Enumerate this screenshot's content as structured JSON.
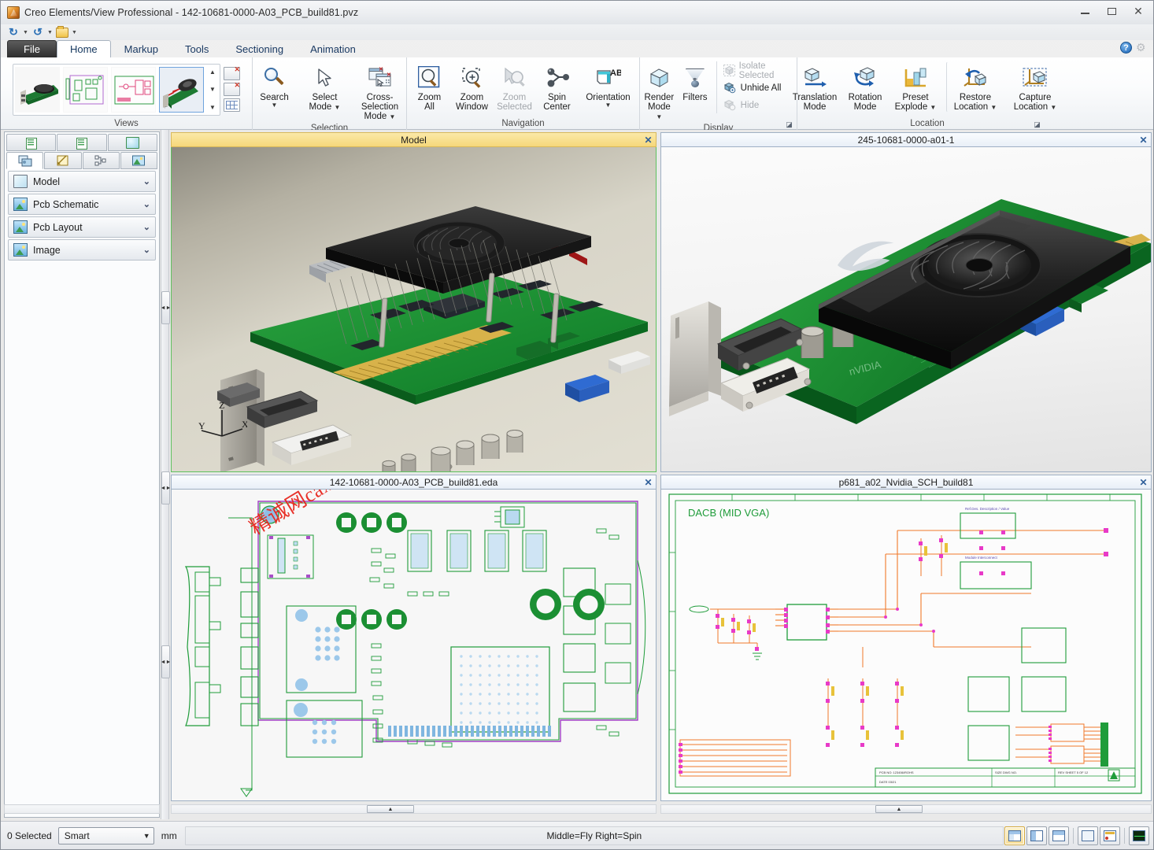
{
  "window": {
    "title": "Creo Elements/View Professional - 142-10681-0000-A03_PCB_build81.pvz",
    "app_icon": "creo-app-icon",
    "minimize": "–",
    "maximize": "□",
    "close": "✕"
  },
  "quick_access": {
    "items": [
      {
        "name": "redo",
        "glyph": "↻"
      },
      {
        "name": "redo-dropdown",
        "glyph": "▾"
      },
      {
        "name": "undo",
        "glyph": "↺"
      },
      {
        "name": "undo-dropdown",
        "glyph": "▾"
      },
      {
        "name": "open-folder",
        "glyph": ""
      },
      {
        "name": "customize-qat",
        "glyph": "▾"
      }
    ]
  },
  "ribbon": {
    "tabs": [
      {
        "label": "File",
        "kind": "file"
      },
      {
        "label": "Home",
        "kind": "active"
      },
      {
        "label": "Markup",
        "kind": "normal"
      },
      {
        "label": "Tools",
        "kind": "normal"
      },
      {
        "label": "Sectioning",
        "kind": "normal"
      },
      {
        "label": "Animation",
        "kind": "normal"
      }
    ],
    "help_button": "?",
    "options_button": "⚙",
    "groups": [
      {
        "name": "views",
        "label": "Views",
        "thumbnails": [
          {
            "name": "view-thumb-photo",
            "selected": false
          },
          {
            "name": "view-thumb-pcb-layout",
            "selected": false
          },
          {
            "name": "view-thumb-schematic",
            "selected": false
          },
          {
            "name": "view-thumb-model-exploded",
            "selected": true
          }
        ],
        "scroll_up": "▲",
        "scroll_down": "▼",
        "scroll_more": "▼",
        "extras": [
          {
            "name": "delete-view-button"
          },
          {
            "name": "delete-all-views-button"
          },
          {
            "name": "views-grid-button"
          }
        ]
      },
      {
        "name": "selection",
        "label": "Selection",
        "buttons": [
          {
            "label": "Search",
            "icon": "magnifier-icon",
            "dropdown": true,
            "disabled": false
          },
          {
            "label": "Select\nMode",
            "icon": "cursor-arrow-icon",
            "dropdown": true,
            "disabled": false,
            "label_line1": "Select",
            "label_line2": "Mode"
          },
          {
            "label": "Cross-Selection\nMode",
            "icon": "cross-selection-icon",
            "dropdown": true,
            "disabled": false,
            "label_line1": "Cross-Selection",
            "label_line2": "Mode"
          }
        ]
      },
      {
        "name": "navigation",
        "label": "Navigation",
        "buttons": [
          {
            "label_line1": "Zoom",
            "label_line2": "All",
            "icon": "zoom-all-icon",
            "disabled": false
          },
          {
            "label_line1": "Zoom",
            "label_line2": "Window",
            "icon": "zoom-window-icon",
            "disabled": false
          },
          {
            "label_line1": "Zoom",
            "label_line2": "Selected",
            "icon": "zoom-selected-icon",
            "disabled": true
          },
          {
            "label_line1": "Spin",
            "label_line2": "Center",
            "icon": "spin-center-icon",
            "disabled": false
          },
          {
            "label_line1": "Orientation",
            "label_line2": "",
            "icon": "orientation-icon",
            "dropdown": true,
            "disabled": false
          }
        ]
      },
      {
        "name": "display",
        "label": "Display",
        "dialog_launcher": "⌐",
        "buttons": [
          {
            "label_line1": "Render",
            "label_line2": "Mode",
            "icon": "render-mode-icon",
            "dropdown": true,
            "disabled": false
          },
          {
            "label_line1": "Filters",
            "label_line2": "",
            "icon": "filters-icon",
            "disabled": false
          }
        ],
        "small_buttons": [
          {
            "label": "Isolate Selected",
            "icon": "isolate-icon",
            "disabled": true
          },
          {
            "label": "Unhide All",
            "icon": "unhide-icon",
            "disabled": false
          },
          {
            "label": "Hide",
            "icon": "hide-icon",
            "disabled": true
          }
        ]
      },
      {
        "name": "location",
        "label": "Location",
        "dialog_launcher": "⌐",
        "buttons": [
          {
            "label_line1": "Translation",
            "label_line2": "Mode",
            "icon": "translation-mode-icon",
            "disabled": false
          },
          {
            "label_line1": "Rotation",
            "label_line2": "Mode",
            "icon": "rotation-mode-icon",
            "disabled": false
          },
          {
            "label_line1": "Preset",
            "label_line2": "Explode",
            "icon": "preset-explode-icon",
            "dropdown": true,
            "disabled": false
          },
          {
            "label_line1": "Restore",
            "label_line2": "Location",
            "icon": "restore-location-icon",
            "dropdown": true,
            "disabled": false
          },
          {
            "label_line1": "Capture",
            "label_line2": "Location",
            "icon": "capture-location-icon",
            "dropdown": true,
            "disabled": false
          }
        ]
      }
    ]
  },
  "sidebar": {
    "top_tabs": [
      {
        "name": "structure-tab-1",
        "icon": "tree-icon"
      },
      {
        "name": "structure-tab-2",
        "icon": "tree-icon"
      },
      {
        "name": "structure-tab-3",
        "icon": "cube-icon"
      }
    ],
    "bottom_tabs": [
      {
        "name": "views-tab",
        "icon": "views-icon",
        "active": true
      },
      {
        "name": "markup-tab",
        "icon": "markup-icon",
        "active": false
      },
      {
        "name": "structure-tree-tab",
        "icon": "hierarchy-icon",
        "active": false
      },
      {
        "name": "images-tab",
        "icon": "image-icon",
        "active": false
      }
    ],
    "items": [
      {
        "label": "Model",
        "icon": "cube-icon",
        "chevron": "⌄"
      },
      {
        "label": "Pcb Schematic",
        "icon": "image-icon",
        "chevron": "⌄"
      },
      {
        "label": "Pcb Layout",
        "icon": "image-icon",
        "chevron": "⌄"
      },
      {
        "label": "Image",
        "icon": "image-icon",
        "chevron": "⌄"
      }
    ]
  },
  "viewports": [
    {
      "name": "viewport-model",
      "title": "Model",
      "active": true,
      "close": "✕",
      "content_type": "3d-exploded-graphics-card",
      "axis": {
        "x": "X",
        "y": "Y",
        "z": "Z"
      }
    },
    {
      "name": "viewport-photo",
      "title": "245-10681-0000-a01-1",
      "active": false,
      "close": "✕",
      "content_type": "3d-rendered-graphics-card"
    },
    {
      "name": "viewport-pcb-layout",
      "title": "142-10681-0000-A03_PCB_build81.eda",
      "active": false,
      "close": "✕",
      "content_type": "pcb-layout-drawing"
    },
    {
      "name": "viewport-schematic",
      "title": "p681_a02_Nvidia_SCH_build81",
      "active": false,
      "close": "✕",
      "content_type": "schematic-drawing",
      "sheet_label": "DACB (MID VGA)"
    }
  ],
  "watermark": {
    "text": "精诚网caxit.com",
    "color": "#e8271f"
  },
  "statusbar": {
    "selection_count": "0 Selected",
    "mode_select": {
      "value": "Smart",
      "arrow": "▼"
    },
    "units": "mm",
    "mouse_hint": "Middle=Fly   Right=Spin",
    "layout_buttons": [
      {
        "name": "layout-quad-button",
        "selected": true,
        "style": "q"
      },
      {
        "name": "layout-vertical-split-button",
        "selected": false,
        "style": "v"
      },
      {
        "name": "layout-horizontal-split-button",
        "selected": false,
        "style": "h"
      },
      {
        "name": "layout-single-button",
        "selected": false,
        "style": "one"
      },
      {
        "name": "annotations-panel-button",
        "selected": false,
        "style": "note"
      },
      {
        "name": "performance-monitor-button",
        "selected": false,
        "style": "ecg"
      }
    ]
  },
  "colors": {
    "accent": "#f6d87a",
    "active_border": "#5ec15e",
    "pcb_green": "#1f9c3a",
    "schematic_orange": "#f0792a",
    "schematic_magenta": "#e83ac8",
    "watermark_red": "#e8271f"
  }
}
